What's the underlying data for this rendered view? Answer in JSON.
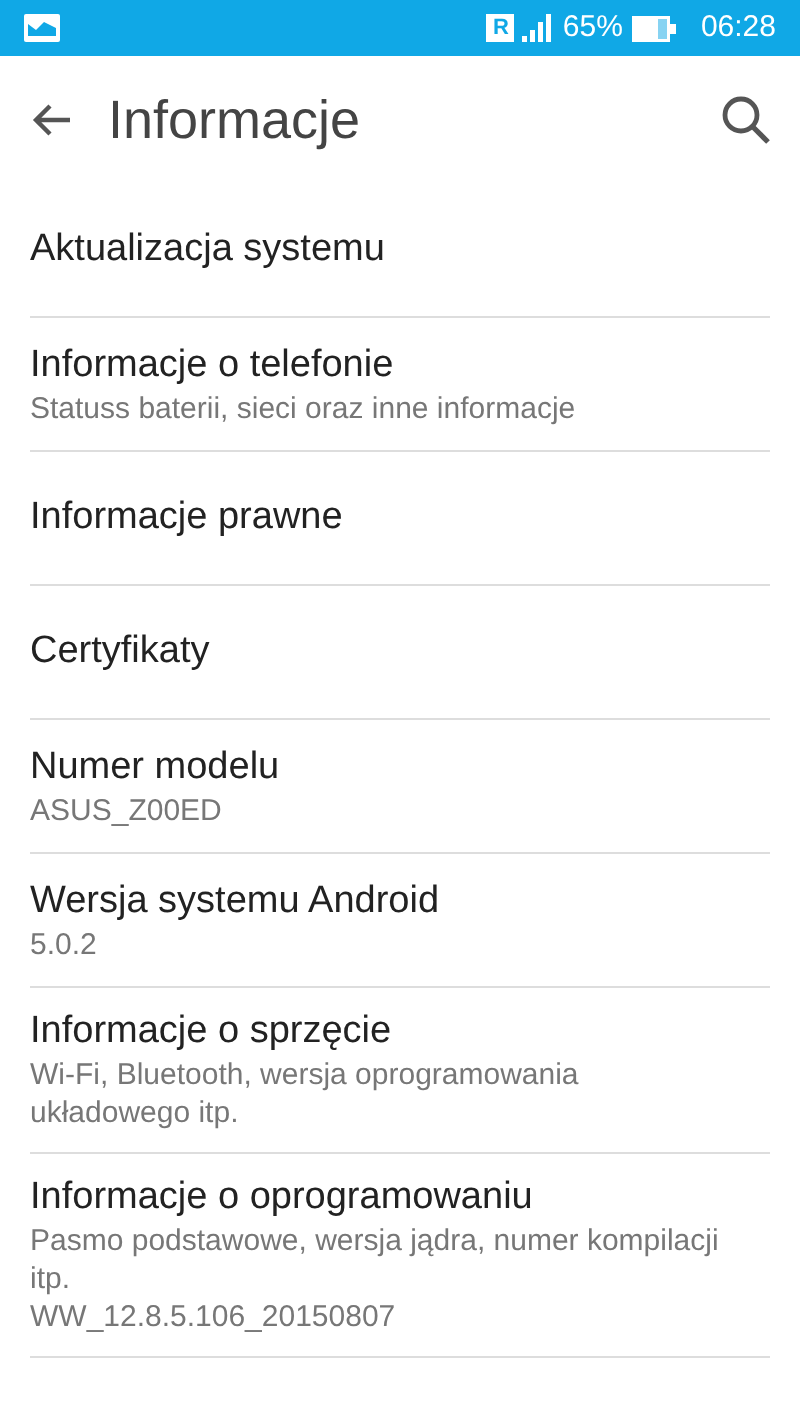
{
  "status_bar": {
    "roaming": "R",
    "battery": "65%",
    "time": "06:28"
  },
  "toolbar": {
    "title": "Informacje"
  },
  "items": [
    {
      "title": "Aktualizacja systemu"
    },
    {
      "title": "Informacje o telefonie",
      "summary": "Statuss baterii, sieci oraz inne informacje"
    },
    {
      "title": "Informacje prawne"
    },
    {
      "title": "Certyfikaty"
    },
    {
      "title": "Numer modelu",
      "summary": "ASUS_Z00ED"
    },
    {
      "title": "Wersja systemu Android",
      "summary": "5.0.2"
    },
    {
      "title": "Informacje o sprzęcie",
      "summary": "Wi-Fi, Bluetooth, wersja oprogramowania układowego itp."
    },
    {
      "title": "Informacje o oprogramowaniu",
      "summary": "Pasmo podstawowe, wersja jądra, numer kompilacji itp.\nWW_12.8.5.106_20150807"
    }
  ]
}
